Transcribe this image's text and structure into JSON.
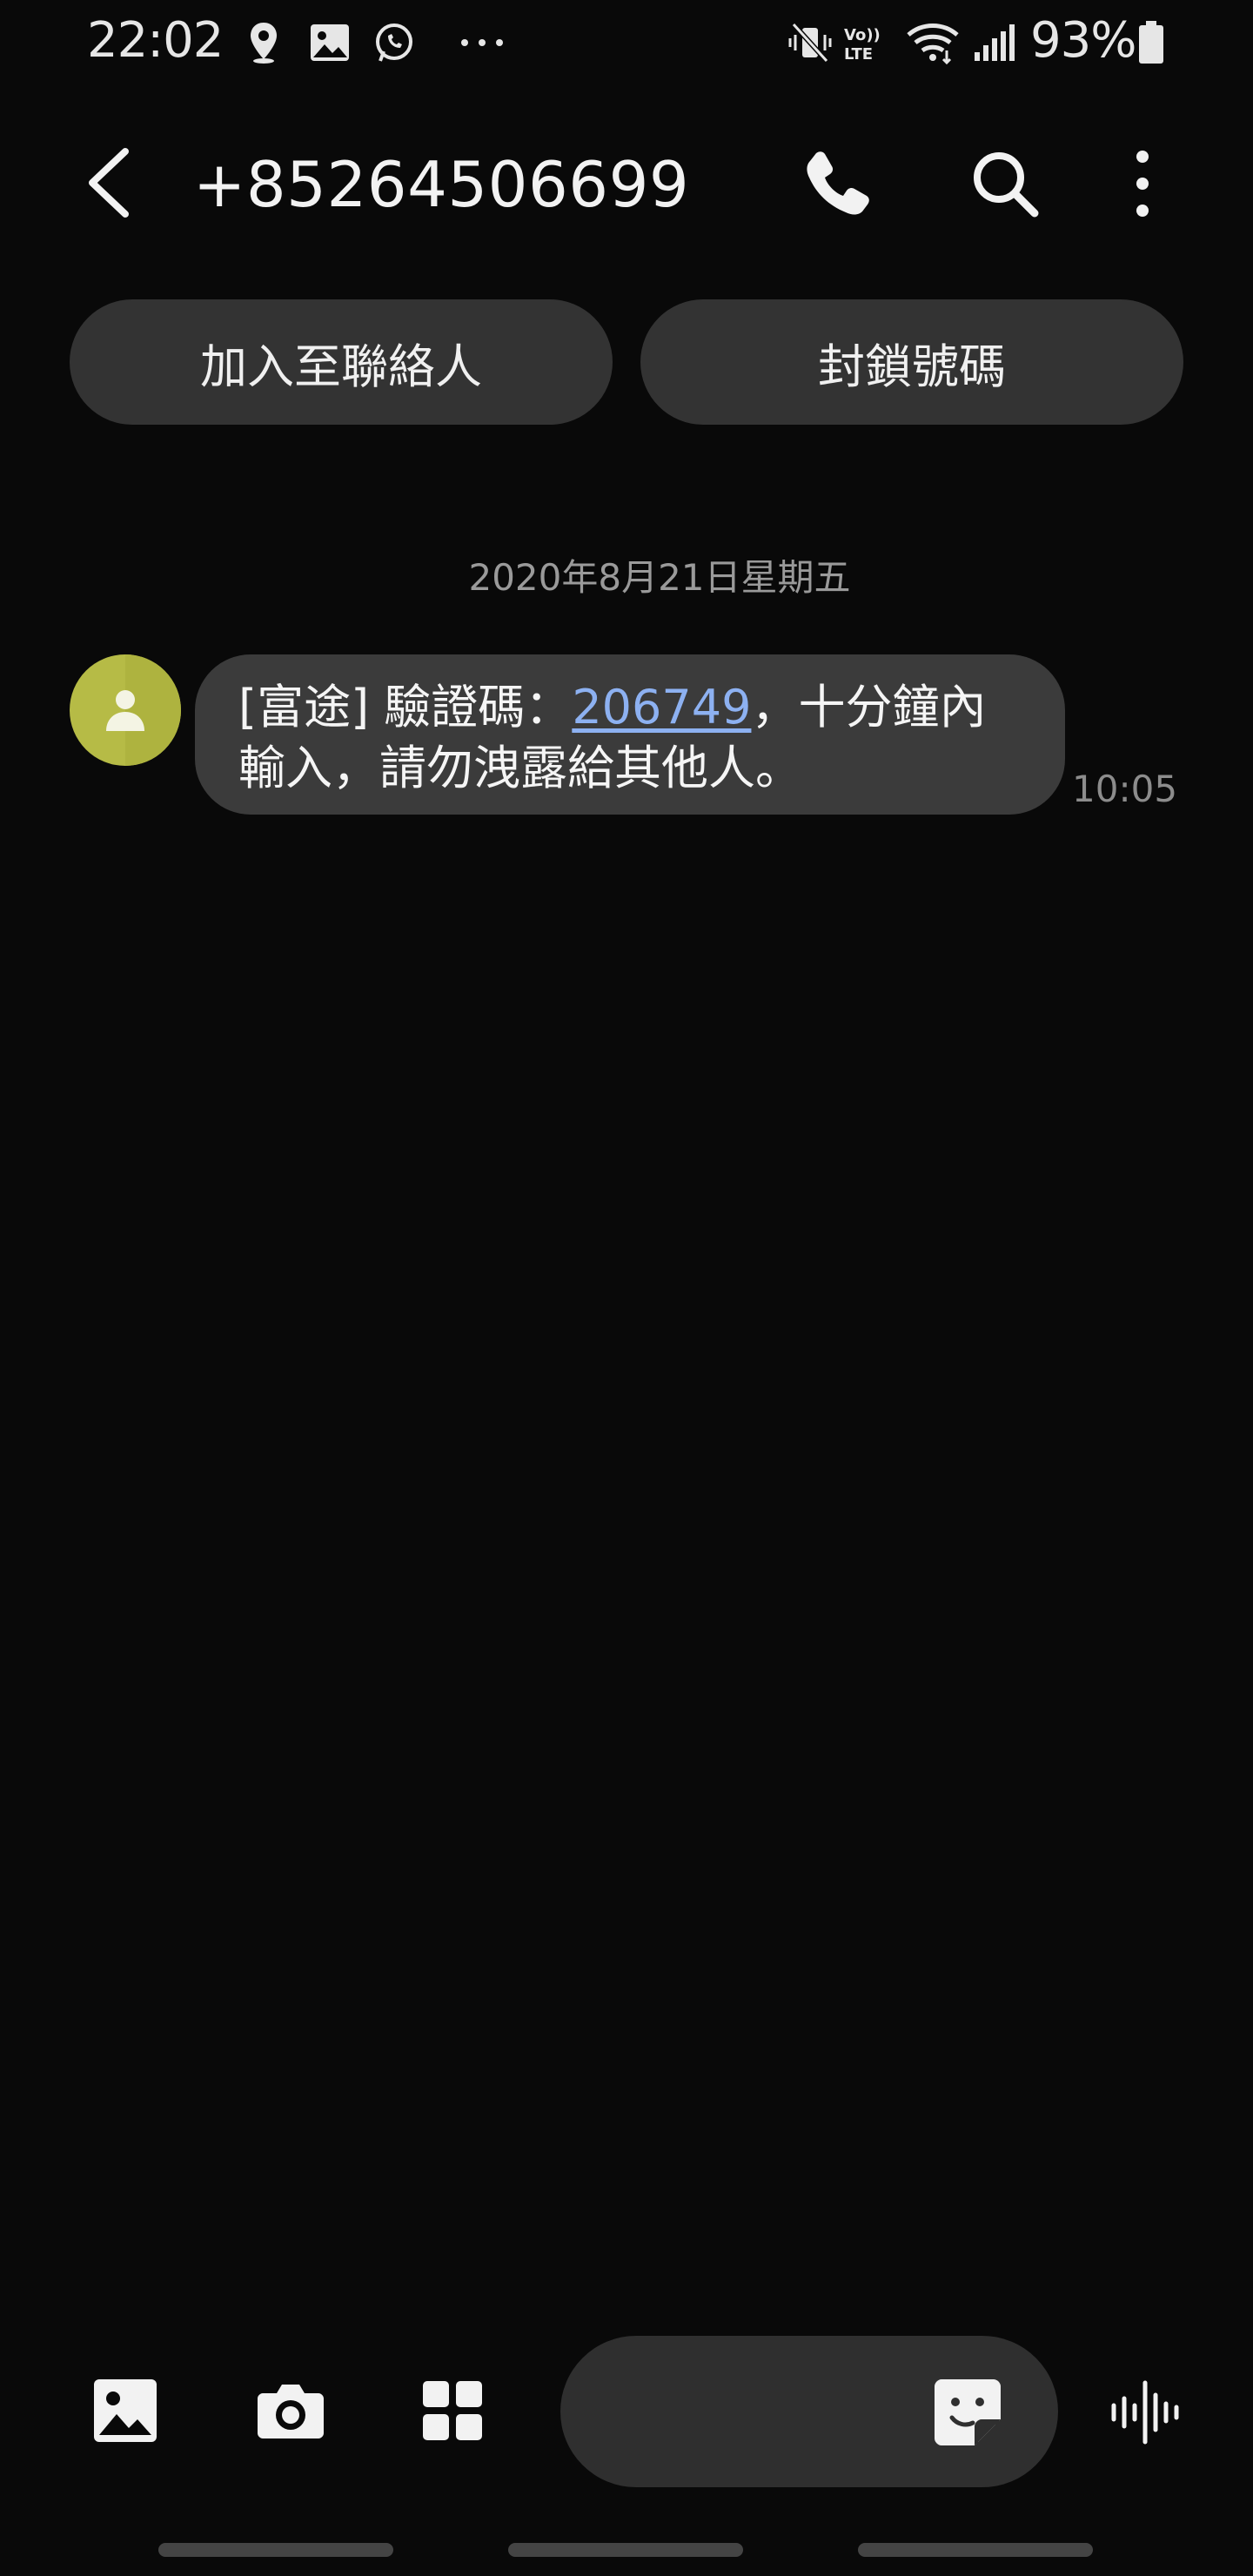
{
  "status_bar": {
    "time": "22:02",
    "notification_icons": [
      "location-pin-icon",
      "gallery-icon",
      "whatsapp-icon",
      "more-dots-icon"
    ],
    "system_icons": [
      "vibrate-mute-icon",
      "volte-icon",
      "wifi-icon",
      "signal-icon",
      "battery-icon"
    ],
    "battery_percent": "93%"
  },
  "app_bar": {
    "title": "+85264506699",
    "actions": [
      "phone-icon",
      "search-icon",
      "more-vert-icon"
    ]
  },
  "actions": {
    "add_contact_label": "加入至聯絡人",
    "block_number_label": "封鎖號碼"
  },
  "conversation": {
    "date_separator": "2020年8月21日星期五",
    "messages": [
      {
        "sender": "+85264506699",
        "text_before": "[富途] 驗證碼：",
        "code": "206749",
        "text_after": "，十分鐘內輸入，請勿洩露給其他人。",
        "time": "10:05"
      }
    ]
  },
  "composer": {
    "buttons": [
      "gallery-icon",
      "camera-icon",
      "apps-grid-icon",
      "sticker-icon",
      "voice-wave-icon"
    ]
  },
  "colors": {
    "background": "#090909",
    "bubble": "#3b3b3b",
    "pill": "#333333",
    "link": "#8db1f1",
    "avatar": "#b6bb46"
  }
}
